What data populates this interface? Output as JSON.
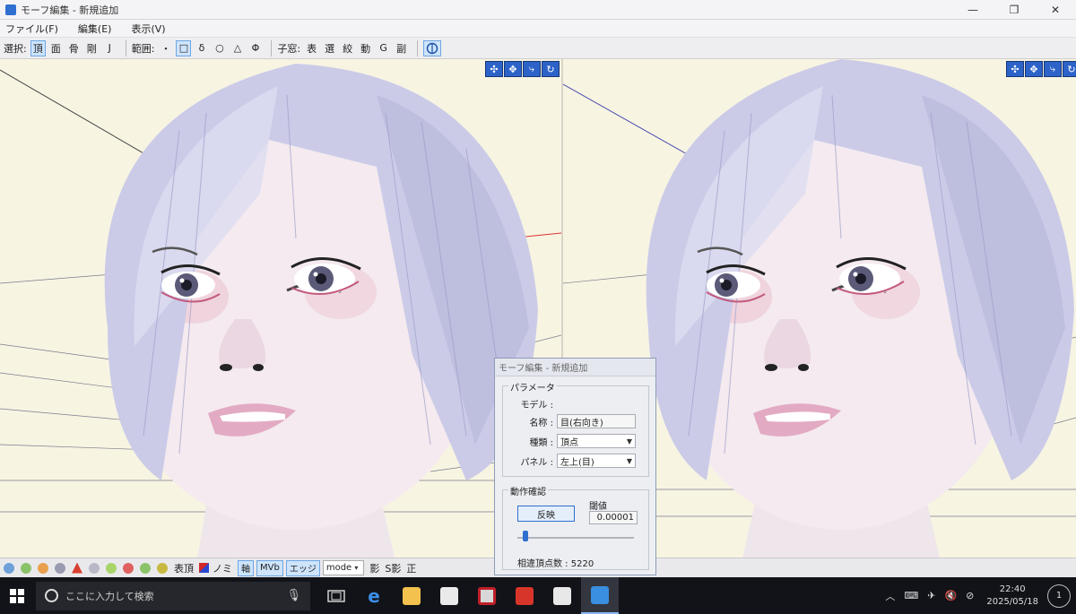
{
  "window": {
    "title": "モーフ編集 - 新規追加",
    "controls": [
      "—",
      "❐",
      "✕"
    ]
  },
  "menu": [
    "ファイル(F)",
    "編集(E)",
    "表示(V)"
  ],
  "toolbar": {
    "select_label": "選択:",
    "select_items": [
      "頂",
      "面",
      "骨",
      "剛",
      "J"
    ],
    "range_label": "範囲:",
    "range_items": [
      "・",
      "□",
      "δ",
      "○",
      "△",
      "Φ"
    ],
    "child_label": "子窓:",
    "child_items": [
      "表",
      "選",
      "絞",
      "動",
      "G",
      "副"
    ]
  },
  "viewport_tools": [
    "✣",
    "✥",
    "⤷",
    "↻"
  ],
  "bottombar": {
    "face_label": "表頂",
    "no_label": "ノミ",
    "axis_label": "軸",
    "mvb_label": "MVb",
    "edge_label": "エッジ",
    "mode_value": "mode",
    "shadow_label": "影",
    "sshadow_label": "S影",
    "ortho_label": "正"
  },
  "dialog": {
    "title": "モーフ編集 - 新規追加",
    "params_group": "パラメータ",
    "model_label": "モデル :",
    "name_label": "名称 :",
    "name_value": "目(右向き)",
    "type_label": "種類 :",
    "type_value": "頂点",
    "panel_label": "パネル :",
    "panel_value": "左上(目)",
    "check_group": "動作確認",
    "reflect_button": "反映",
    "threshold_label": "閾値",
    "threshold_value": "0.00001",
    "count_text": "相違頂点数 : 5220"
  },
  "taskbar": {
    "search_placeholder": "ここに入力して検索",
    "time": "22:40",
    "date": "2025/05/18",
    "notification_count": "1"
  },
  "colors": {
    "viewport_bg": "#f7f4e2",
    "accent": "#2f6fd0",
    "hair": "#c9c8e6",
    "skin": "#f2e8ee"
  }
}
